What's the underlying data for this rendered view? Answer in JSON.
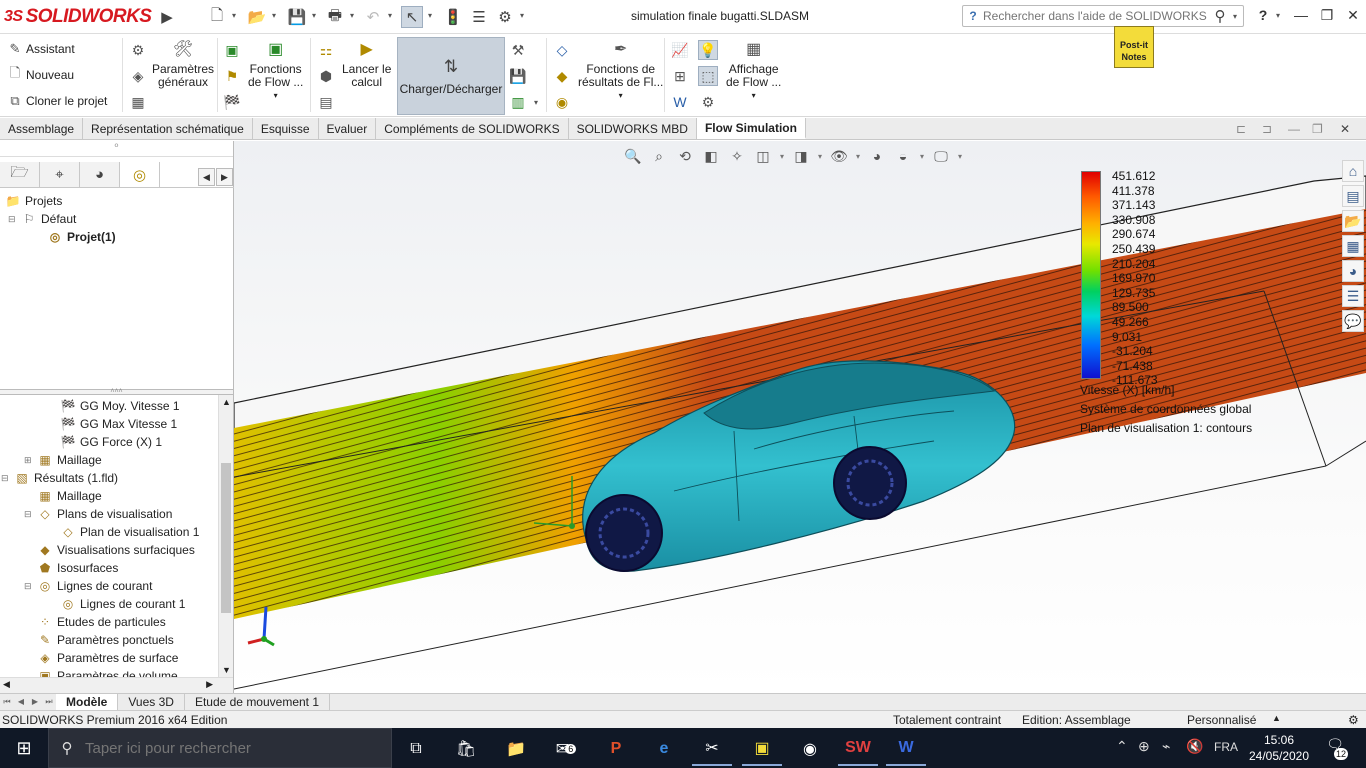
{
  "app": {
    "logo_text": "SOLIDWORKS",
    "logo_prefix": "3S",
    "doc_title": "simulation finale bugatti.SLDASM",
    "help_search_placeholder": "Rechercher dans l'aide de SOLIDWORKS",
    "help_btn": "?",
    "minimize": "—",
    "restore": "❐",
    "close": "✕"
  },
  "ribbon": {
    "assistant": "Assistant",
    "nouveau": "Nouveau",
    "cloner": "Cloner le projet",
    "params_l1": "Paramètres",
    "params_l2": "généraux",
    "fonctions_l1": "Fonctions",
    "fonctions_l2": "de Flow ...",
    "lancer_l1": "Lancer le",
    "lancer_l2": "calcul",
    "charger": "Charger/Décharger",
    "resultats_l1": "Fonctions de",
    "resultats_l2": "résultats de Fl...",
    "affichage_l1": "Affichage",
    "affichage_l2": "de Flow ...",
    "postit_l1": "Post-it",
    "postit_l2": "Notes"
  },
  "command_tabs": [
    "Assemblage",
    "Représentation schématique",
    "Esquisse",
    "Evaluer",
    "Compléments de SOLIDWORKS",
    "SOLIDWORKS MBD",
    "Flow Simulation"
  ],
  "tree_top": {
    "projets": "Projets",
    "defaut": "Défaut",
    "projet1": "Projet(1)"
  },
  "tree_lower": [
    {
      "label": "GG Moy. Vitesse 1",
      "indent": 3,
      "icon": "flag-icon"
    },
    {
      "label": "GG Max Vitesse 1",
      "indent": 3,
      "icon": "flag-icon"
    },
    {
      "label": "GG Force (X) 1",
      "indent": 3,
      "icon": "flag-icon"
    },
    {
      "label": "Maillage",
      "indent": 2,
      "icon": "mesh-icon"
    },
    {
      "label": "Résultats (1.fld)",
      "indent": 1,
      "icon": "results-icon"
    },
    {
      "label": "Maillage",
      "indent": 2,
      "icon": "mesh-icon"
    },
    {
      "label": "Plans de visualisation",
      "indent": 2,
      "icon": "plane-icon"
    },
    {
      "label": "Plan de visualisation 1",
      "indent": 3,
      "icon": "plane-icon"
    },
    {
      "label": "Visualisations surfaciques",
      "indent": 2,
      "icon": "surface-icon"
    },
    {
      "label": "Isosurfaces",
      "indent": 2,
      "icon": "isosurface-icon"
    },
    {
      "label": "Lignes de courant",
      "indent": 2,
      "icon": "flowline-icon"
    },
    {
      "label": "Lignes de courant 1",
      "indent": 3,
      "icon": "flowline-icon"
    },
    {
      "label": "Etudes de particules",
      "indent": 2,
      "icon": "particle-icon"
    },
    {
      "label": "Paramètres ponctuels",
      "indent": 2,
      "icon": "point-icon"
    },
    {
      "label": "Paramètres de surface",
      "indent": 2,
      "icon": "surface-param-icon"
    },
    {
      "label": "Paramètres de volume",
      "indent": 2,
      "icon": "volume-icon"
    }
  ],
  "legend": {
    "values": [
      "451.612",
      "411.378",
      "371.143",
      "330.908",
      "290.674",
      "250.439",
      "210.204",
      "169.970",
      "129.735",
      "89.500",
      "49.266",
      "9.031",
      "-31.204",
      "-71.438",
      "-111.673"
    ],
    "quantity": "Vitesse (X) [km/h]",
    "coord": "Système de coordonnées global",
    "plane": "Plan de visualisation 1: contours"
  },
  "bottom_tabs": [
    "Modèle",
    "Vues 3D",
    "Etude de mouvement 1"
  ],
  "status": {
    "edition": "SOLIDWORKS Premium 2016 x64 Edition",
    "contraint": "Totalement contraint",
    "mode": "Edition: Assemblage",
    "perso": "Personnalisé"
  },
  "taskbar": {
    "search_placeholder": "Taper ici pour rechercher",
    "mail_badge": "6",
    "lang": "FRA",
    "time": "15:06",
    "date": "24/05/2020",
    "notif_count": "12"
  },
  "colors": {
    "brand": "#d71920",
    "accent_load": "#c9d2dc",
    "flow_orange": "#c74a18",
    "car_body": "#2fb3c4"
  }
}
